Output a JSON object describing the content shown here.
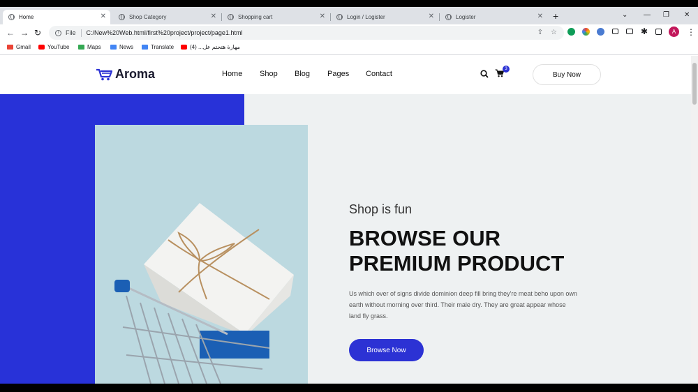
{
  "browser": {
    "tabs": [
      {
        "title": "Home",
        "active": true
      },
      {
        "title": "Shop Category",
        "active": false
      },
      {
        "title": "Shopping cart",
        "active": false
      },
      {
        "title": "Login / Logister",
        "active": false
      },
      {
        "title": "Logister",
        "active": false
      }
    ],
    "address": {
      "scheme_label": "File",
      "url": "C:/New%20Web.html/first%20project/project/page1.html"
    },
    "bookmarks": [
      {
        "label": "Gmail",
        "color": "#ea4335"
      },
      {
        "label": "YouTube",
        "color": "#ff0000"
      },
      {
        "label": "Maps",
        "color": "#34a853"
      },
      {
        "label": "News",
        "color": "#4285f4"
      },
      {
        "label": "Translate",
        "color": "#4285f4"
      },
      {
        "label": "مهارة هتحتم عل... (4)",
        "color": "#ff0000"
      }
    ],
    "profile_initial": "A"
  },
  "site": {
    "brand": "Aroma",
    "nav": [
      "Home",
      "Shop",
      "Blog",
      "Pages",
      "Contact"
    ],
    "cart_count": "3",
    "cta": "Buy Now",
    "accent": "#2c32d4"
  },
  "hero": {
    "kicker": "Shop is fun",
    "headline_line1": "BROWSE OUR",
    "headline_line2": "PREMIUM PRODUCT",
    "description": "Us which over of signs divide dominion deep fill bring they're meat beho upon own earth without morning over third. Their male dry. They are great appear whose land fly grass.",
    "button": "Browse Now"
  }
}
